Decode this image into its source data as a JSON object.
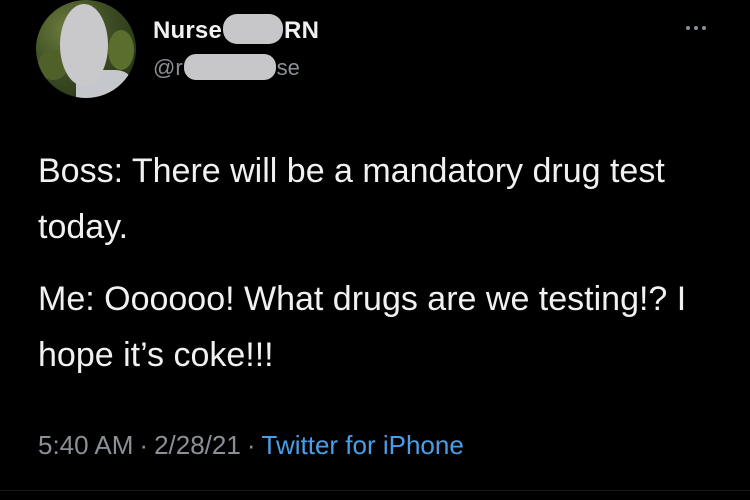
{
  "author": {
    "name_prefix": "Nurse",
    "name_suffix": "RN",
    "handle_prefix": "@r",
    "handle_suffix": "se"
  },
  "tweet": {
    "paragraphs": [
      "Boss: There will be a mandatory drug test today.",
      "Me: Oooooo! What drugs are we testing!? I hope it’s coke!!!"
    ],
    "time": "5:40 AM",
    "date": "2/28/21",
    "source": "Twitter for iPhone",
    "separator": "·"
  },
  "icons": {
    "more": "more-horizontal-icon"
  },
  "colors": {
    "background": "#000000",
    "text": "#f1f1f1",
    "secondary": "#8b9096",
    "link": "#4a9ee6",
    "redaction": "#c7c7c9"
  }
}
